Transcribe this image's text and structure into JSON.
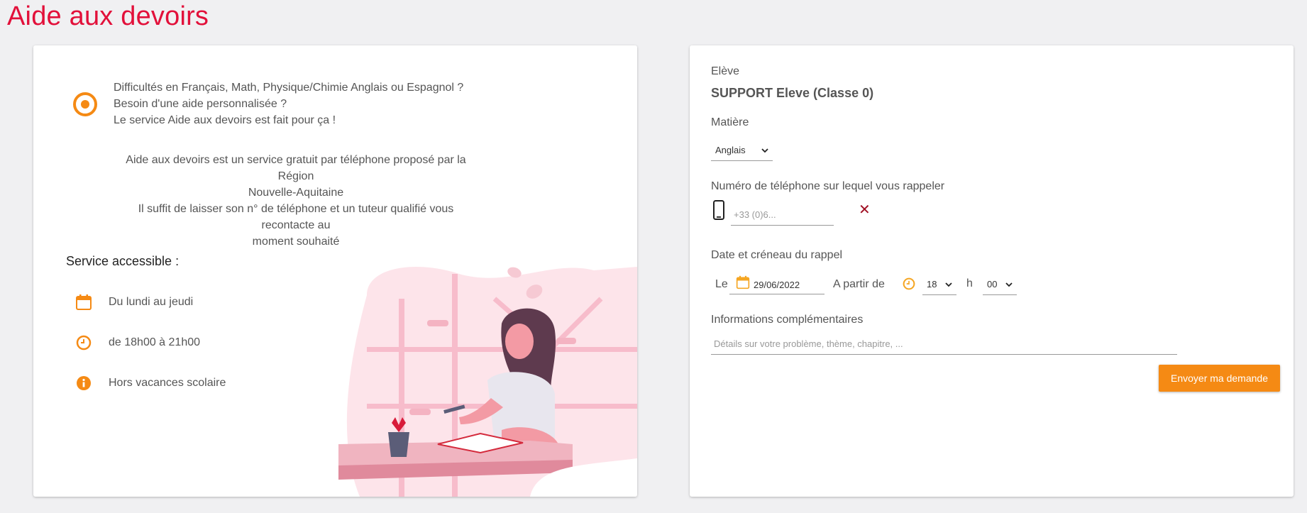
{
  "page_title": "Aide aux devoirs",
  "intro": {
    "line1": "Difficultés en Français, Math, Physique/Chimie Anglais ou Espagnol ?",
    "line2": "Besoin d'une aide personnalisée ?",
    "line3": "Le service Aide aux devoirs est fait pour ça !"
  },
  "description": {
    "line1": "Aide aux devoirs est un service gratuit par téléphone proposé par la Région",
    "line2": "Nouvelle-Aquitaine",
    "line3": "Il suffit de laisser son n° de téléphone et un tuteur qualifié vous recontacte au",
    "line4": "moment souhaité"
  },
  "service": {
    "heading": "Service accessible :",
    "items": [
      {
        "icon": "calendar-icon",
        "label": "Du lundi au jeudi"
      },
      {
        "icon": "clock-icon",
        "label": "de 18h00 à 21h00"
      },
      {
        "icon": "info-icon",
        "label": "Hors vacances scolaire"
      }
    ]
  },
  "form": {
    "student_label": "Elève",
    "student_name": "SUPPORT Eleve (Classe 0)",
    "subject_label": "Matière",
    "subject_value": "Anglais",
    "phone_label": "Numéro de téléphone sur lequel vous rappeler",
    "phone_placeholder": "+33 (0)6...",
    "date_section_label": "Date et créneau du rappel",
    "date_prefix": "Le",
    "date_value": "29/06/2022",
    "from_label": "A partir de",
    "hour_value": "18",
    "hour_sep": "h",
    "minute_value": "00",
    "info_label": "Informations complémentaires",
    "info_placeholder": "Détails sur votre problème, thème, chapitre, ...",
    "submit_label": "Envoyer ma demande"
  },
  "colors": {
    "title": "#e2103a",
    "accent": "#f58a14",
    "clear": "#a00f23"
  }
}
